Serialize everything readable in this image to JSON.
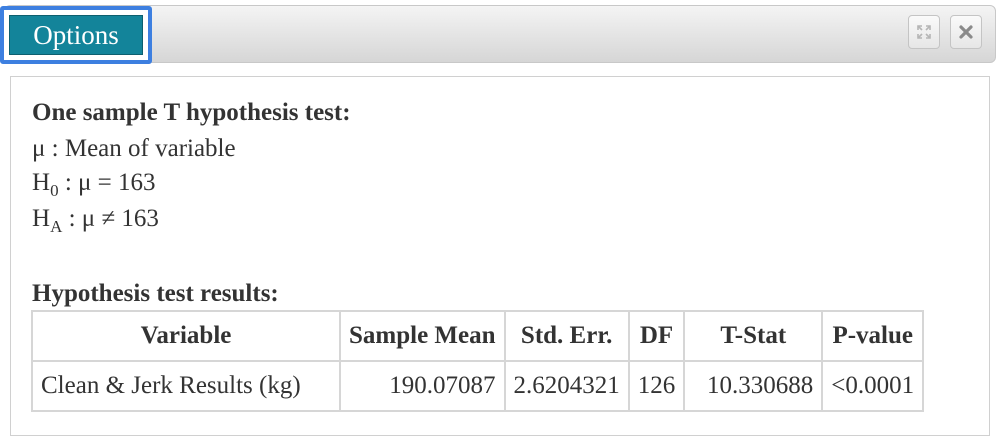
{
  "window": {
    "options_label": "Options",
    "expand_icon": "expand-arrows-icon",
    "close_icon": "close-x-icon"
  },
  "test": {
    "title": "One sample T hypothesis test:",
    "mu_def": "μ : Mean of variable",
    "h0_prefix": "H",
    "h0_sub": "0",
    "h0_rest": " : μ = 163",
    "ha_prefix": "H",
    "ha_sub": "A",
    "ha_rest": " : μ ≠ 163"
  },
  "results": {
    "title": "Hypothesis test results:",
    "columns": [
      "Variable",
      "Sample Mean",
      "Std. Err.",
      "DF",
      "T-Stat",
      "P-value"
    ],
    "rows": [
      [
        "Clean & Jerk Results (kg)",
        "190.07087",
        "2.6204321",
        "126",
        "10.330688",
        "<0.0001"
      ]
    ]
  },
  "colors": {
    "options_bg": "#13849a",
    "focus_ring": "#3d7fe0"
  }
}
